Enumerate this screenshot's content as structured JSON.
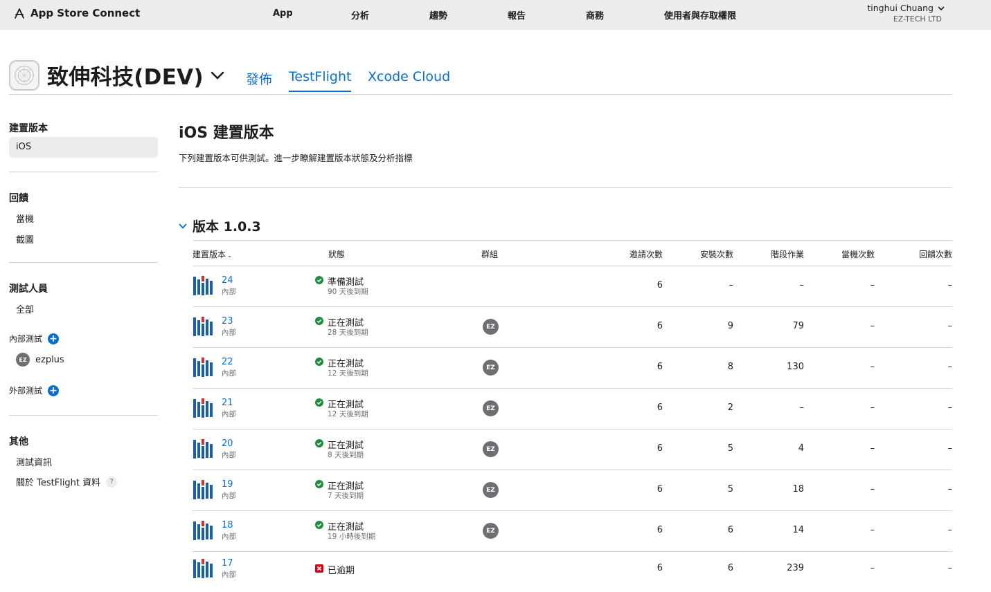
{
  "topbar": {
    "brand": "App Store Connect",
    "nav": [
      "App",
      "分析",
      "趨勢",
      "報告",
      "商務",
      "使用者與存取權限"
    ],
    "user_name": "tinghui Chuang",
    "user_org": "EZ-TECH LTD"
  },
  "app": {
    "name": "致伸科技(DEV)",
    "tabs": [
      "發佈",
      "TestFlight",
      "Xcode Cloud"
    ],
    "active_tab": "TestFlight"
  },
  "sidebar": {
    "builds_heading": "建置版本",
    "builds_items": [
      "iOS"
    ],
    "feedback_heading": "回饋",
    "feedback_items": [
      "當機",
      "截圖"
    ],
    "testers_heading": "測試人員",
    "testers_all": "全部",
    "internal_label": "內部測試",
    "internal_group": {
      "initials": "EZ",
      "name": "ezplus"
    },
    "external_label": "外部測試",
    "other_heading": "其他",
    "other_items": [
      "測試資訊",
      "關於 TestFlight 資料"
    ],
    "help_glyph": "?"
  },
  "main": {
    "title": "iOS 建置版本",
    "subtitle": "下列建置版本可供測試。進一步瞭解建置版本狀態及分析指標",
    "version_label": "版本 1.0.3",
    "columns": {
      "build": "建置版本",
      "status": "狀態",
      "groups": "群組",
      "invites": "邀請次數",
      "installs": "安裝次數",
      "sessions": "階段作業",
      "crashes": "當機次數",
      "feedback": "回饋次數"
    },
    "builds": [
      {
        "number": "24",
        "type": "內部",
        "status": "準備測試",
        "expiry": "90 天後到期",
        "state": "ok",
        "group": "",
        "invites": "6",
        "installs": "–",
        "sessions": "–",
        "crashes": "–",
        "feedback": "–"
      },
      {
        "number": "23",
        "type": "內部",
        "status": "正在測試",
        "expiry": "28 天後到期",
        "state": "ok",
        "group": "EZ",
        "invites": "6",
        "installs": "9",
        "sessions": "79",
        "crashes": "–",
        "feedback": "–"
      },
      {
        "number": "22",
        "type": "內部",
        "status": "正在測試",
        "expiry": "12 天後到期",
        "state": "ok",
        "group": "EZ",
        "invites": "6",
        "installs": "8",
        "sessions": "130",
        "crashes": "–",
        "feedback": "–"
      },
      {
        "number": "21",
        "type": "內部",
        "status": "正在測試",
        "expiry": "12 天後到期",
        "state": "ok",
        "group": "EZ",
        "invites": "6",
        "installs": "2",
        "sessions": "–",
        "crashes": "–",
        "feedback": "–"
      },
      {
        "number": "20",
        "type": "內部",
        "status": "正在測試",
        "expiry": "8 天後到期",
        "state": "ok",
        "group": "EZ",
        "invites": "6",
        "installs": "5",
        "sessions": "4",
        "crashes": "–",
        "feedback": "–"
      },
      {
        "number": "19",
        "type": "內部",
        "status": "正在測試",
        "expiry": "7 天後到期",
        "state": "ok",
        "group": "EZ",
        "invites": "6",
        "installs": "5",
        "sessions": "18",
        "crashes": "–",
        "feedback": "–"
      },
      {
        "number": "18",
        "type": "內部",
        "status": "正在測試",
        "expiry": "19 小時後到期",
        "state": "ok",
        "group": "EZ",
        "invites": "6",
        "installs": "6",
        "sessions": "14",
        "crashes": "–",
        "feedback": "–"
      },
      {
        "number": "17",
        "type": "內部",
        "status": "已逾期",
        "expiry": "",
        "state": "expired",
        "group": "",
        "invites": "6",
        "installs": "6",
        "sessions": "239",
        "crashes": "–",
        "feedback": "–"
      }
    ]
  },
  "colors": {
    "accent": "#0a6ed1",
    "ok": "#1e8e3e",
    "expired": "#d70015",
    "thumb_blue": "#1a5fa8",
    "thumb_red": "#d1342c"
  },
  "icons": {
    "brand": "app-store-icon",
    "status_ok": "check-circle-icon",
    "status_expired": "x-square-icon"
  }
}
